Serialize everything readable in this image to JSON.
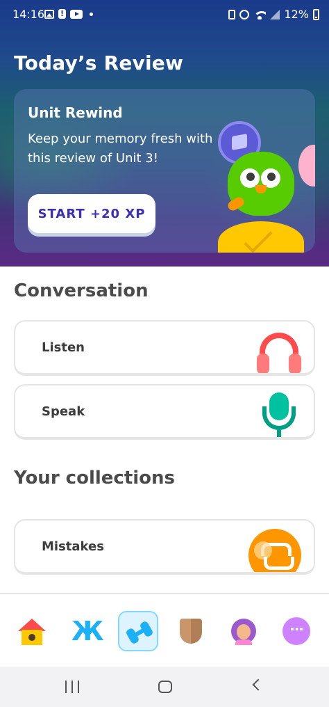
{
  "status_bar": {
    "time": "14:16",
    "battery_text": "12%",
    "icons_left": [
      "gallery-icon",
      "alert-icon",
      "youtube-icon",
      "dot-icon"
    ],
    "icons_right": [
      "sim-icon",
      "alarm-icon",
      "wifi-icon",
      "signal-icon",
      "battery-icon"
    ]
  },
  "hero": {
    "title": "Today’s Review",
    "card": {
      "title": "Unit Rewind",
      "description": "Keep your memory fresh with this review of Unit 3!",
      "button_label": "START +20 XP"
    }
  },
  "conversation": {
    "title": "Conversation",
    "items": [
      {
        "label": "Listen",
        "icon": "headphones-icon"
      },
      {
        "label": "Speak",
        "icon": "microphone-icon"
      }
    ]
  },
  "collections": {
    "title": "Your collections",
    "items": [
      {
        "label": "Mistakes",
        "icon": "mistakes-icon"
      }
    ]
  },
  "bottom_nav": {
    "items": [
      "home-icon",
      "letters-icon",
      "practice-icon",
      "leagues-icon",
      "profile-icon",
      "more-icon"
    ],
    "active": "practice-icon",
    "letters_glyph": "Ж",
    "more_glyph": "···"
  },
  "colors": {
    "accent_blue": "#1cb0f6",
    "button_text": "#3a2fb8",
    "brand_green": "#58cc02"
  }
}
